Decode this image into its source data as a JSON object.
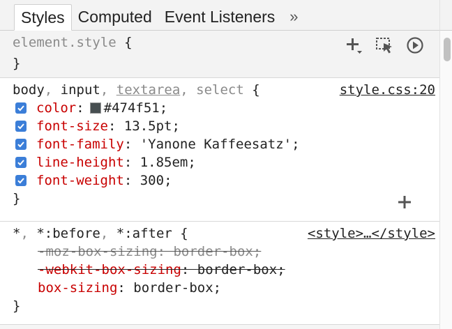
{
  "tabs": [
    {
      "label": "Styles",
      "active": true
    },
    {
      "label": "Computed",
      "active": false
    },
    {
      "label": "Event Listeners",
      "active": false
    }
  ],
  "more_tabs_glyph": "»",
  "element_style": {
    "selector": "element.style",
    "open_brace": "{",
    "close_brace": "}",
    "toolbar_icons": [
      "new-style-rule-icon",
      "element-state-icon",
      "animations-icon"
    ]
  },
  "rule1": {
    "selectors": [
      {
        "text": "body",
        "matched": true
      },
      {
        "text": "input",
        "matched": true
      },
      {
        "text": "textarea",
        "matched": false
      },
      {
        "text": "select",
        "matched": true
      }
    ],
    "open_brace": "{",
    "close_brace": "}",
    "source": "style.css:20",
    "properties": [
      {
        "name": "color",
        "value": "#474f51",
        "swatch": "#474f51",
        "checked": true
      },
      {
        "name": "font-size",
        "value": "13.5pt",
        "checked": true
      },
      {
        "name": "font-family",
        "value": "'Yanone Kaffeesatz'",
        "checked": true
      },
      {
        "name": "line-height",
        "value": "1.85em",
        "checked": true
      },
      {
        "name": "font-weight",
        "value": "300",
        "checked": true
      }
    ],
    "add_icon": "plus-icon"
  },
  "rule2": {
    "selectors": [
      "*",
      "*:before",
      "*:after"
    ],
    "open_brace": "{",
    "close_brace": "}",
    "source": "<style>…</style>",
    "properties": [
      {
        "name": "-moz-box-sizing",
        "value": "border-box",
        "overridden": true,
        "invalid": true
      },
      {
        "name": "-webkit-box-sizing",
        "value": "border-box",
        "overridden": true,
        "invalid": false
      },
      {
        "name": "box-sizing",
        "value": "border-box",
        "overridden": false
      }
    ]
  },
  "colors": {
    "property_name": "#c80000",
    "checkbox": "#3b7ed8",
    "panel_bg": "#f3f3f3"
  }
}
